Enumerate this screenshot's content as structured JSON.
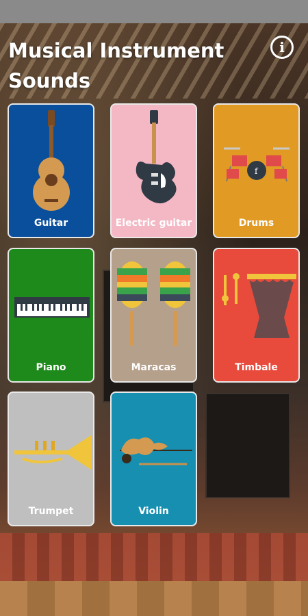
{
  "app": {
    "title": "Musical Instrument Sounds",
    "info_icon": "info-icon",
    "info_glyph": "i"
  },
  "instruments": [
    {
      "label": "Guitar",
      "icon": "guitar-icon",
      "color": "#0a4f9c"
    },
    {
      "label": "Electric guitar",
      "icon": "electric-guitar-icon",
      "color": "#f4b7c4"
    },
    {
      "label": "Drums",
      "icon": "drums-icon",
      "color": "#e19b24"
    },
    {
      "label": "Piano",
      "icon": "piano-keyboard-icon",
      "color": "#1f8a1c"
    },
    {
      "label": "Maracas",
      "icon": "maracas-icon",
      "color": "#b5a08c"
    },
    {
      "label": "Timbale",
      "icon": "timbale-icon",
      "color": "#e84a3c"
    },
    {
      "label": "Trumpet",
      "icon": "trumpet-icon",
      "color": "#bfbfbf"
    },
    {
      "label": "Violin",
      "icon": "violin-icon",
      "color": "#178fb1"
    }
  ]
}
